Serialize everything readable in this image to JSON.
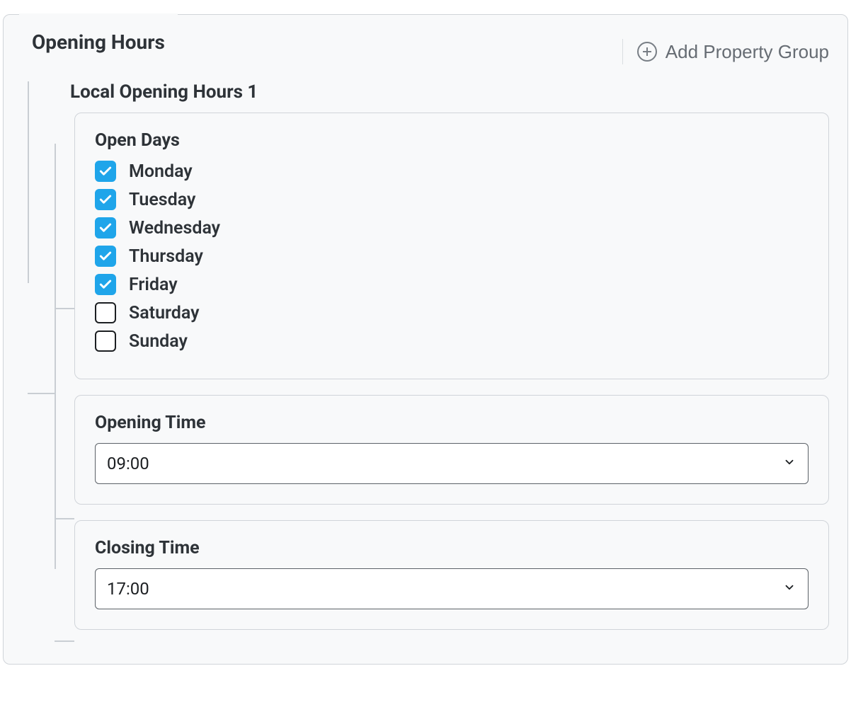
{
  "panel": {
    "title": "Opening Hours",
    "addButton": "Add Property Group"
  },
  "subgroup": {
    "title": "Local Opening Hours 1",
    "openDays": {
      "title": "Open Days",
      "days": [
        {
          "label": "Monday",
          "checked": true
        },
        {
          "label": "Tuesday",
          "checked": true
        },
        {
          "label": "Wednesday",
          "checked": true
        },
        {
          "label": "Thursday",
          "checked": true
        },
        {
          "label": "Friday",
          "checked": true
        },
        {
          "label": "Saturday",
          "checked": false
        },
        {
          "label": "Sunday",
          "checked": false
        }
      ]
    },
    "openingTime": {
      "title": "Opening Time",
      "value": "09:00"
    },
    "closingTime": {
      "title": "Closing Time",
      "value": "17:00"
    }
  }
}
